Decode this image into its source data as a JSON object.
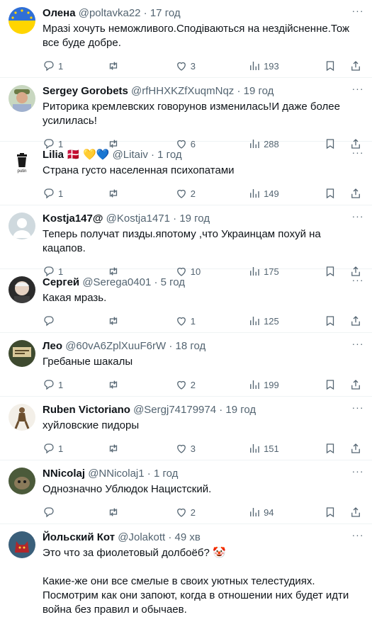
{
  "tweets": [
    {
      "name": "Олена",
      "handle": "@poltavka22",
      "time": "17 год",
      "text": "Мразі хочуть неможливого.Сподіваються на нездійсненне.Тож все буде добре.",
      "replies": "1",
      "retweets": "",
      "likes": "3",
      "views": "193",
      "avatar_icon": "ukraine-flag-avatar"
    },
    {
      "name": "Sergey Gorobets",
      "handle": "@rfHHXKZfXuqmNqz",
      "time": "19 год",
      "text": "Риторика кремлевских говорунов изменилась!И даже более усилилась!",
      "replies": "1",
      "retweets": "",
      "likes": "6",
      "views": "288",
      "avatar_icon": "man-hat-avatar"
    },
    {
      "name": "Lilia",
      "handle": "@Litaiv",
      "time": "1 год",
      "text": "Страна густо населенная психопатами",
      "replies": "1",
      "retweets": "",
      "likes": "2",
      "views": "149",
      "avatar_icon": "trash-putin-avatar",
      "avatar_text": "putin",
      "flag_emoji": "🇩🇰",
      "hearts": "💛💙"
    },
    {
      "name": "Kostja147@",
      "handle": "@Kostja1471",
      "time": "19 год",
      "text": "Теперь получат пизды.япотому ,что Украинцам похуй на кацапов.",
      "replies": "1",
      "retweets": "",
      "likes": "10",
      "views": "175",
      "avatar_icon": "default-person-avatar"
    },
    {
      "name": "Сергей",
      "handle": "@Serega0401",
      "time": "5 год",
      "text": "Какая мразь.",
      "replies": "",
      "retweets": "",
      "likes": "1",
      "views": "125",
      "avatar_icon": "older-man-avatar"
    },
    {
      "name": "Лео",
      "handle": "@60vA6ZplXuuF6rW",
      "time": "18 год",
      "text": "Гребаные шакалы",
      "replies": "1",
      "retweets": "",
      "likes": "2",
      "views": "199",
      "avatar_icon": "sign-avatar"
    },
    {
      "name": "Ruben Victoriano",
      "handle": "@Sergj74179974",
      "time": "19 год",
      "text": "хуйловские пидоры",
      "replies": "1",
      "retweets": "",
      "likes": "3",
      "views": "151",
      "avatar_icon": "soldier-figure-avatar"
    },
    {
      "name": "NNicolaj",
      "handle": "@NNicolaj1",
      "time": "1 год",
      "text": "Однозначно Ублюдок Нацистский.",
      "replies": "",
      "retweets": "",
      "likes": "2",
      "views": "94",
      "avatar_icon": "creature-avatar"
    },
    {
      "name": "Йольский Кот",
      "handle": "@Jolakott",
      "time": "49 хв",
      "text": "Это что за фиолетовый долбоёб? 🤡\n\nКакие-же они все смелые в своих уютных телестудиях. Посмотрим как они запоют, когда в отношении них будет идти война без правил и обычаев.",
      "replies": "",
      "retweets": "",
      "likes": "",
      "views": "",
      "avatar_icon": "red-cat-avatar"
    }
  ],
  "sep": "·",
  "more_label": "···",
  "colors": {
    "text": "#0f1419",
    "muted": "#536471",
    "divider": "#eff3f4"
  }
}
